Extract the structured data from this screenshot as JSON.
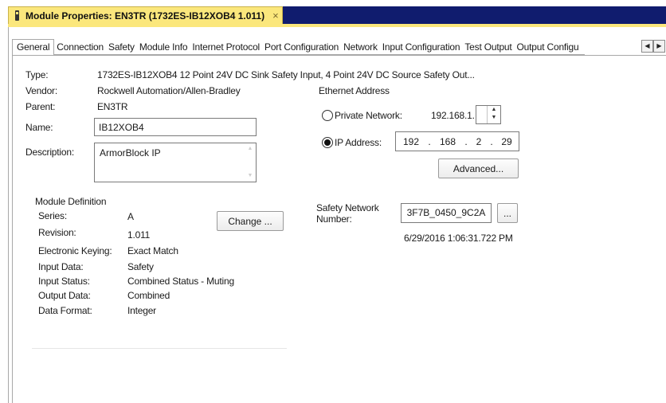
{
  "window": {
    "title": "Module Properties: EN3TR (1732ES-IB12XOB4 1.011)",
    "close_glyph": "×"
  },
  "tabs": [
    {
      "label": "General",
      "active": true
    },
    {
      "label": "Connection"
    },
    {
      "label": "Safety"
    },
    {
      "label": "Module Info"
    },
    {
      "label": "Internet Protocol"
    },
    {
      "label": "Port Configuration"
    },
    {
      "label": "Network"
    },
    {
      "label": "Input Configuration"
    },
    {
      "label": "Test Output"
    },
    {
      "label": "Output Configu"
    }
  ],
  "tab_scroll": {
    "left": "◀",
    "right": "▶"
  },
  "general": {
    "type_label": "Type:",
    "type_value": "1732ES-IB12XOB4 12 Point 24V DC Sink Safety Input, 4 Point 24V DC Source Safety Out...",
    "vendor_label": "Vendor:",
    "vendor_value": "Rockwell Automation/Allen-Bradley",
    "parent_label": "Parent:",
    "parent_value": "EN3TR",
    "name_label": "Name:",
    "name_value": "IB12XOB4",
    "description_label": "Description:",
    "description_value": "ArmorBlock IP"
  },
  "module_definition": {
    "heading": "Module Definition",
    "rows": [
      {
        "label": "Series:",
        "value": "A"
      },
      {
        "label": "Revision:",
        "value": "1.011"
      },
      {
        "label": "Electronic Keying:",
        "value": "Exact Match"
      },
      {
        "label": "Input Data:",
        "value": "Safety"
      },
      {
        "label": "Input Status:",
        "value": "Combined Status - Muting"
      },
      {
        "label": "Output Data:",
        "value": "Combined"
      },
      {
        "label": "Data Format:",
        "value": "Integer"
      }
    ],
    "change_button": "Change ..."
  },
  "ethernet": {
    "heading": "Ethernet Address",
    "private_network_label": "Private Network:",
    "private_network_value": "192.168.1.",
    "private_selected": false,
    "ip_address_label": "IP Address:",
    "ip_selected": true,
    "ip_octets": [
      "192",
      "168",
      "2",
      "29"
    ],
    "advanced_button": "Advanced..."
  },
  "safety_network": {
    "label_line1": "Safety Network",
    "label_line2": "Number:",
    "value": "3F7B_0450_9C2A",
    "browse_button": "...",
    "timestamp": "6/29/2016 1:06:31.722 PM"
  }
}
